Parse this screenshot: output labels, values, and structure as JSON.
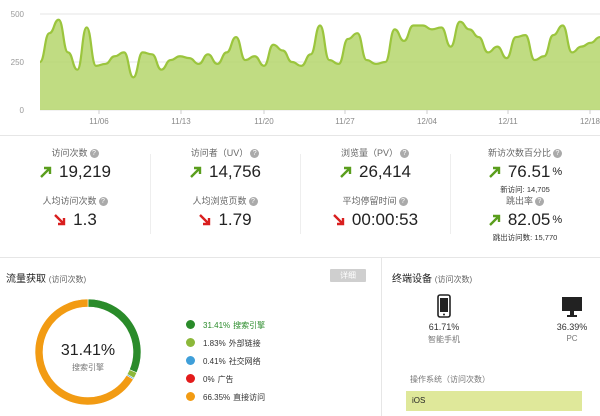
{
  "chart_data": {
    "type": "area",
    "ylim": [
      0,
      500
    ],
    "yticks": [
      "0",
      "250",
      "500"
    ],
    "xticks": [
      "11/06",
      "11/13",
      "11/20",
      "11/27",
      "12/04",
      "12/11",
      "12/18"
    ],
    "grid": true,
    "color": "#9bc53d",
    "values": [
      250,
      400,
      470,
      300,
      210,
      430,
      230,
      240,
      280,
      300,
      170,
      300,
      290,
      210,
      260,
      280,
      270,
      240,
      290,
      240,
      300,
      380,
      260,
      280,
      230,
      340,
      310,
      250,
      230,
      290,
      440,
      260,
      240,
      370,
      400,
      260,
      240,
      250,
      420,
      360,
      440,
      440,
      420,
      430,
      330,
      460,
      420,
      380,
      300,
      330,
      270,
      380,
      390,
      260,
      280,
      390,
      440,
      300,
      330,
      350,
      380
    ]
  },
  "metrics": [
    {
      "label": "访问次数",
      "value": "19,219",
      "trend": "up"
    },
    {
      "label": "访问者（UV）",
      "value": "14,756",
      "trend": "up"
    },
    {
      "label": "浏览量（PV）",
      "value": "26,414",
      "trend": "up"
    },
    {
      "label": "新访次数百分比",
      "value": "76.51",
      "unit": "%",
      "trend": "up",
      "sub": "新访问: 14,705"
    },
    {
      "label": "人均访问次数",
      "value": "1.3",
      "trend": "down"
    },
    {
      "label": "人均浏览页数",
      "value": "1.79",
      "trend": "down"
    },
    {
      "label": "平均停留时间",
      "value": "00:00:53",
      "trend": "down"
    },
    {
      "label": "跳出率",
      "value": "82.05",
      "unit": "%",
      "trend": "up",
      "sub": "跳出访问数: 15,770"
    }
  ],
  "colors": {
    "up": "#5a9e1d",
    "down": "#d91f1f",
    "help": "#aaaaaa"
  },
  "traffic": {
    "title": "流量获取",
    "subtitle": "(访问次数)",
    "detail_label": "详细",
    "center_pct": "31.41%",
    "center_label": "搜索引擎",
    "sources": [
      {
        "pct": "31.41%",
        "label": "搜索引擎",
        "value": 31.41,
        "color": "#2a8b2a",
        "label_color": "#2a8b2a"
      },
      {
        "pct": "1.83%",
        "label": "外部链接",
        "value": 1.83,
        "color": "#8cb83a",
        "label_color": "#333333"
      },
      {
        "pct": "0.41%",
        "label": "社交网络",
        "value": 0.41,
        "color": "#3f9fd9",
        "label_color": "#333333"
      },
      {
        "pct": "0%",
        "label": "广告",
        "value": 0,
        "color": "#e31b1b",
        "label_color": "#333333"
      },
      {
        "pct": "66.35%",
        "label": "直接访问",
        "value": 66.35,
        "color": "#f29b13",
        "label_color": "#333333"
      }
    ]
  },
  "device": {
    "title": "终端设备",
    "subtitle": "(访问次数)",
    "phone_icon": "smartphone-icon",
    "pc_icon": "monitor-icon",
    "phone_pct": "61.71%",
    "phone_label": "智能手机",
    "pc_pct": "36.39%",
    "pc_label": "PC",
    "os_title": "操作系统（访问次数）",
    "os_first": "iOS"
  }
}
